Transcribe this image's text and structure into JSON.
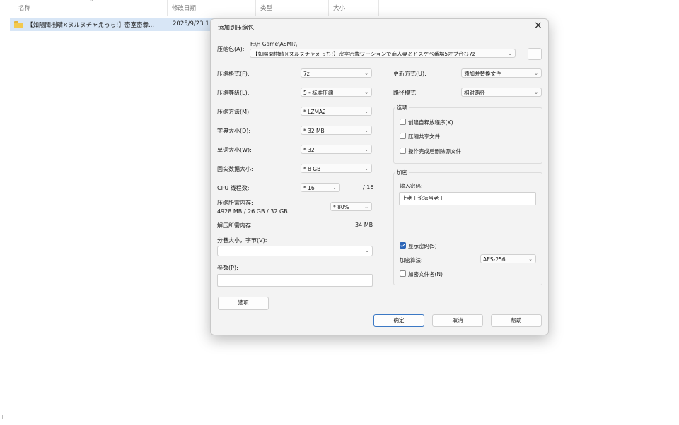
{
  "explorer": {
    "columns": {
      "name": "名称",
      "date": "修改日期",
      "type": "类型",
      "size": "大小"
    },
    "row": {
      "name": "【如陽聞樹晴×ヌルヌチャえっち!】密室密釁...",
      "date": "2025/9/23 1"
    }
  },
  "dialog": {
    "title": "添加到压缩包",
    "archive": {
      "label": "压缩包(A):",
      "path": "F:\\H Game\\ASMR\\",
      "value": "【如陽聞樹晴×ヌルヌチャえっち!】密室密釁ワーションで商人妻とドスケベ番場5オブ合ひ7z",
      "browse_label": "..."
    },
    "left": {
      "format": {
        "label": "压缩格式(F):",
        "value": "7z"
      },
      "level": {
        "label": "压缩等级(L):",
        "value": "5 - 标准压缩"
      },
      "method": {
        "label": "压缩方法(M):",
        "value": "* LZMA2"
      },
      "dict": {
        "label": "字典大小(D):",
        "value": "* 32 MB"
      },
      "word": {
        "label": "单词大小(W):",
        "value": "* 32"
      },
      "solid": {
        "label": "固实数据大小:",
        "value": "* 8 GB"
      },
      "cpu": {
        "label": "CPU 线程数:",
        "value": "* 16",
        "total": "/ 16"
      },
      "mem_compress": {
        "label": "压缩所需内存:",
        "detail": "4928 MB / 26 GB / 32 GB",
        "value": "* 80%"
      },
      "mem_decompress": {
        "label": "解压所需内存:",
        "value": "34 MB"
      },
      "split": {
        "label": "分卷大小，字节(V):",
        "value": ""
      },
      "params": {
        "label": "参数(P):",
        "value": ""
      },
      "options_button": "选项"
    },
    "right": {
      "update": {
        "label": "更新方式(U):",
        "value": "添加并替换文件"
      },
      "path_mode": {
        "label": "路径模式",
        "value": "相对路径"
      },
      "options": {
        "title": "选项",
        "items": [
          {
            "label": "创建自释放程序(X)",
            "checked": false
          },
          {
            "label": "压缩共享文件",
            "checked": false
          },
          {
            "label": "操作完成后删除源文件",
            "checked": false
          }
        ]
      },
      "encryption": {
        "title": "加密",
        "password_label": "输入密码:",
        "password_value": "上老王论坛当老王",
        "show_password": {
          "label": "显示密码(S)",
          "checked": true
        },
        "method_label": "加密算法:",
        "method_value": "AES-256",
        "encrypt_names": {
          "label": "加密文件名(N)",
          "checked": false
        }
      }
    },
    "buttons": {
      "ok": "确定",
      "cancel": "取消",
      "help": "帮助"
    }
  }
}
